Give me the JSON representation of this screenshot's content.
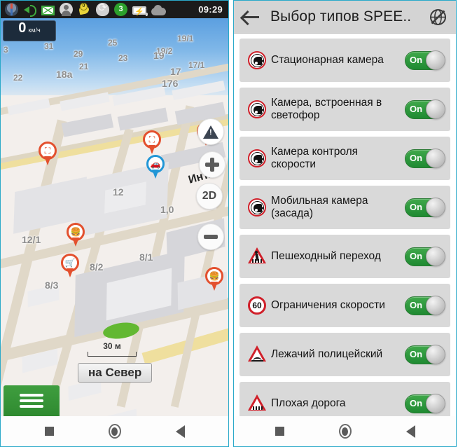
{
  "left_phone": {
    "status_bar": {
      "icons": [
        {
          "name": "gps-compass-icon"
        },
        {
          "name": "volume-speaker-icon"
        },
        {
          "name": "mail-envelope-icon"
        },
        {
          "name": "contact-person-icon"
        },
        {
          "name": "satellite-dish-icon",
          "badge": "0"
        },
        {
          "name": "sync-refresh-icon"
        },
        {
          "name": "notification-count-icon",
          "badge": "3"
        },
        {
          "name": "battery-charging-icon"
        },
        {
          "name": "weather-cloud-icon"
        }
      ],
      "clock": "09:29"
    },
    "speed_widget": {
      "value": "0",
      "unit": "км/ч"
    },
    "map": {
      "house_numbers": [
        "3",
        "31",
        "29",
        "25",
        "23",
        "19/1",
        "19/2",
        "21",
        "22",
        "18a",
        "17/1",
        "17",
        "19",
        "176",
        "12",
        "1,0",
        "12/1",
        "8/1",
        "8/2",
        "8/3"
      ],
      "street_label": "Инт..",
      "scale_text": "30 м",
      "orientation_button": "на Север",
      "buttons": {
        "warning": "warning-icon",
        "zoom_in": "+",
        "zoom_out": "−",
        "view_mode": "2D",
        "menu": "hamburger-menu-icon"
      }
    },
    "nav_bar": {
      "recent": "recents-square-icon",
      "home": "home-circle-icon",
      "back": "back-triangle-icon"
    }
  },
  "right_phone": {
    "app_bar": {
      "back": "back-arrow-icon",
      "title": "Выбор типов SPEE..",
      "action": "no-globe-icon"
    },
    "items": [
      {
        "icon": "camera-sign-icon",
        "label": "Стационарная камера",
        "toggle": "On",
        "state": true
      },
      {
        "icon": "camera-sign-icon",
        "label": "Камера, встроенная в светофор",
        "toggle": "On",
        "state": true
      },
      {
        "icon": "camera-sign-icon",
        "label": "Камера контроля скорости",
        "toggle": "On",
        "state": true
      },
      {
        "icon": "camera-sign-icon",
        "label": "Мобильная камера (засада)",
        "toggle": "On",
        "state": true
      },
      {
        "icon": "pedestrian-crossing-icon",
        "label": "Пешеходный переход",
        "toggle": "On",
        "state": true
      },
      {
        "icon": "speed-limit-60-icon",
        "label": "Ограничения скорости",
        "toggle": "On",
        "state": true,
        "sign_value": "60"
      },
      {
        "icon": "speed-bump-icon",
        "label": "Лежачий полицейский",
        "toggle": "On",
        "state": true
      },
      {
        "icon": "bad-road-icon",
        "label": "Плохая дорога",
        "toggle": "On",
        "state": true
      }
    ],
    "nav_bar": {
      "recent": "recents-square-icon",
      "home": "home-circle-icon",
      "back": "back-triangle-icon"
    }
  },
  "colors": {
    "toggle_on": "#2f9a3c",
    "app_bar": "#d4d4d4",
    "row_bg": "#d9d9d9",
    "sign_red": "#d0202a",
    "menu_green": "#3f9e3f",
    "phone_border": "#2aa9c9"
  }
}
